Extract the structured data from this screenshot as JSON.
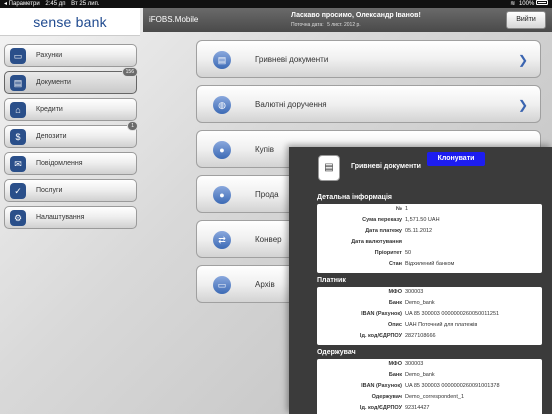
{
  "status_bar": {
    "carrier": "◂ Параметри",
    "time": "2:45 дп",
    "date": "Вт 25 лип.",
    "wifi": "wifi-icon",
    "battery_pct": "100%"
  },
  "brand": {
    "logo_text": "sense bank"
  },
  "header": {
    "app_name": "iFOBS.Mobile",
    "welcome": "Ласкаво просимо, Олександр Іванов!",
    "op_date_label": "Поточна дата:",
    "op_date_value": "5 лист. 2012 р.",
    "logout_label": "Вийти"
  },
  "nav": {
    "items": [
      {
        "label": "Рахунки",
        "icon": "wallet-icon",
        "badge": ""
      },
      {
        "label": "Документи",
        "icon": "documents-icon",
        "badge": "156",
        "active": true
      },
      {
        "label": "Кредити",
        "icon": "home-icon",
        "badge": ""
      },
      {
        "label": "Депозити",
        "icon": "moneybag-icon",
        "badge": "1"
      },
      {
        "label": "Повідомлення",
        "icon": "envelope-icon",
        "badge": ""
      },
      {
        "label": "Послуги",
        "icon": "thumbs-up-icon",
        "badge": ""
      },
      {
        "label": "Налаштування",
        "icon": "gear-icon",
        "badge": ""
      }
    ]
  },
  "main_list": {
    "items": [
      {
        "label": "Гривневі документи",
        "icon": "document-icon"
      },
      {
        "label": "Валютні доручення",
        "icon": "globe-icon"
      },
      {
        "label": "Купів",
        "icon": "coin-icon"
      },
      {
        "label": "Прода",
        "icon": "coin-icon"
      },
      {
        "label": "Конвер",
        "icon": "exchange-icon"
      },
      {
        "label": "Архів",
        "icon": "folder-icon"
      }
    ]
  },
  "modal": {
    "title": "Гривневі документи",
    "clone_label": "Клонувати",
    "details_title": "Детальна інформація",
    "details": [
      {
        "k": "№",
        "v": "1"
      },
      {
        "k": "Сума переказу",
        "v": "1,571.50  UAH"
      },
      {
        "k": "Дата платежу",
        "v": "05.11.2012"
      },
      {
        "k": "Дата валютування",
        "v": ""
      },
      {
        "k": "Пріоритет",
        "v": "50"
      },
      {
        "k": "Стан",
        "v": "Відхилений банком"
      }
    ],
    "payer_title": "Платник",
    "payer": [
      {
        "k": "МФО",
        "v": "300003"
      },
      {
        "k": "Банк",
        "v": "Demo_bank"
      },
      {
        "k": "IBAN (Рахунок)",
        "v": "UA 85 300003 0000000260050011251"
      },
      {
        "k": "Опис",
        "v": "UAH Поточний для платежів"
      },
      {
        "k": "Ід. код/ЄДРПОУ",
        "v": "2827108666"
      }
    ],
    "recipient_title": "Одержувач",
    "recipient": [
      {
        "k": "МФО",
        "v": "300003"
      },
      {
        "k": "Банк",
        "v": "Demo_bank"
      },
      {
        "k": "IBAN (Рахунок)",
        "v": "UA 85 300003 0000000260091001378"
      },
      {
        "k": "Одержувач",
        "v": "Demo_correspondent_1"
      },
      {
        "k": "Ід. код/ЄДРПОУ",
        "v": "92314427"
      }
    ]
  }
}
